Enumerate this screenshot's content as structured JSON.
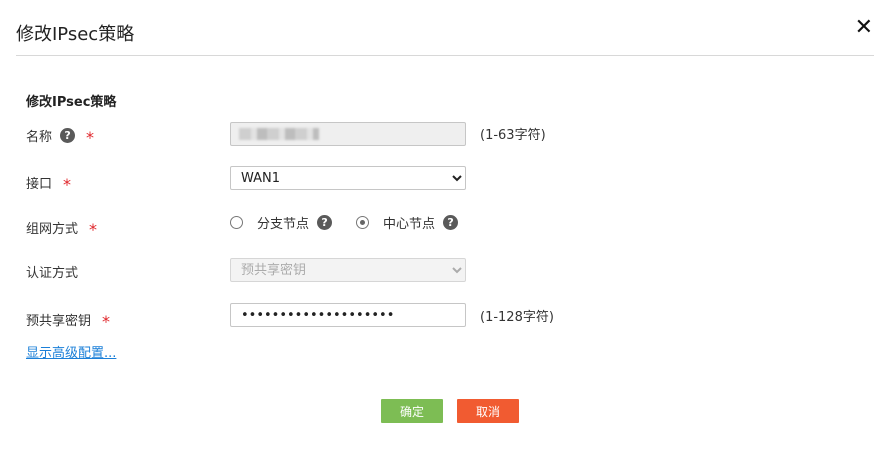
{
  "dialog": {
    "title": "修改IPsec策略",
    "close_glyph": "✕"
  },
  "section_title": "修改IPsec策略",
  "fields": {
    "name": {
      "label": "名称",
      "value": "",
      "hint": "(1-63字符)"
    },
    "interface": {
      "label": "接口",
      "selected": "WAN1",
      "options": [
        "WAN1"
      ]
    },
    "network_mode": {
      "label": "组网方式",
      "options": [
        "分支节点",
        "中心节点"
      ],
      "selected": "中心节点"
    },
    "auth_method": {
      "label": "认证方式",
      "selected": "预共享密钥",
      "options": [
        "预共享密钥"
      ]
    },
    "psk": {
      "label": "预共享密钥",
      "value": "••••••••••••••••••••",
      "hint": "(1-128字符)"
    }
  },
  "help_glyph": "?",
  "required_glyph": "*",
  "advanced_link": "显示高级配置...",
  "buttons": {
    "ok": "确定",
    "cancel": "取消"
  },
  "colors": {
    "ok": "#7dbd54",
    "cancel": "#f15b31",
    "required": "#e0252a",
    "link": "#1a7fd8"
  }
}
